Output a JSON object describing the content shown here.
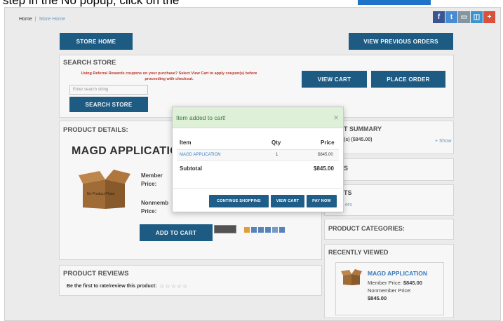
{
  "top_banner": {
    "text": "step in the No popup, click on the",
    "highlight_color": "#1f73c9"
  },
  "breadcrumb": {
    "home": "Home",
    "separator": "|",
    "current": "Store Home"
  },
  "social_icons": [
    {
      "name": "facebook-icon",
      "glyph": "f",
      "color": "#3b5998"
    },
    {
      "name": "twitter-icon",
      "glyph": "t",
      "color": "#4a90d9"
    },
    {
      "name": "print-icon",
      "glyph": "▭",
      "color": "#8a9aa6"
    },
    {
      "name": "share-icon",
      "glyph": "◫",
      "color": "#3c9ad6"
    },
    {
      "name": "plus-icon",
      "glyph": "+",
      "color": "#e0533e"
    }
  ],
  "buttons": {
    "store_home": "STORE HOME",
    "view_previous_orders": "VIEW PREVIOUS ORDERS",
    "view_cart": "VIEW CART",
    "place_order": "PLACE ORDER",
    "search_store": "SEARCH STORE",
    "add_to_cart": "ADD TO CART"
  },
  "search": {
    "title": "SEARCH STORE",
    "referral_note": "Using Referral Rewards coupons on your purchase? Select View Cart to apply coupon(s) before proceeding with checkout.",
    "placeholder": "Enter search string"
  },
  "product": {
    "section_title": "PRODUCT DETAILS:",
    "name": "MAGD APPLICATIO",
    "image_text": "No Product Photo",
    "member_label": "Member Price:",
    "nonmember_label": "Nonmemb Price:"
  },
  "reviews": {
    "title": "PRODUCT REVIEWS",
    "prompt": "Be the first to rate/review this product:",
    "stars": "☆☆☆☆☆"
  },
  "right": {
    "summary_title": "T SUMMARY",
    "summary_line": "(s) ($845.00)",
    "show_link": "+ Show",
    "s_label": "S",
    "ts_label": "TS",
    "ers_label": "ers",
    "categories_title": "PRODUCT CATEGORIES:",
    "recent_title": "RECENTLY VIEWED",
    "recent_item": {
      "name": "MAGD APPLICATION",
      "member_label": "Member Price:",
      "member_price": "$845.00",
      "nonmember_label": "Nonmember Price:",
      "nonmember_price": "$845.00"
    }
  },
  "modal": {
    "title": "Item added to cart!",
    "close": "×",
    "columns": {
      "item": "Item",
      "qty": "Qty",
      "price": "Price"
    },
    "row": {
      "item": "MAGD APPLICATION",
      "qty": "1",
      "price": "$845.00"
    },
    "subtotal_label": "Subtotal",
    "subtotal_value": "$845.00",
    "buttons": {
      "continue": "CONTINUE SHOPPING",
      "view_cart": "VIEW CART",
      "pay_now": "PAY NOW"
    }
  }
}
